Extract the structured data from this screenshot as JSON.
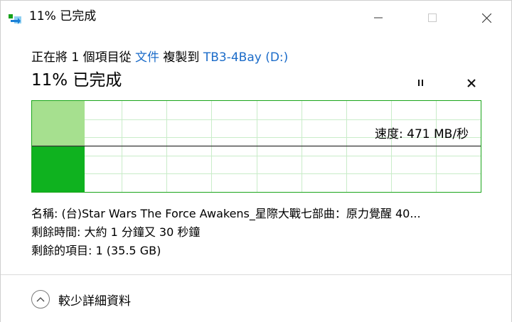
{
  "window": {
    "title": "11% 已完成"
  },
  "header": {
    "prefix": "正在將 1 個項目從 ",
    "source": "文件",
    "middle": " 複製到 ",
    "destination": "TB3-4Bay (D:)"
  },
  "status": {
    "percent_complete": 11,
    "label": "11% 已完成"
  },
  "graph": {
    "speed_label": "速度: 471 MB/秒",
    "progress_fraction": 0.11,
    "colors": {
      "border": "#1aa51a",
      "grid": "#c9ecc9",
      "completed_area": "#a6e08f",
      "speed_fill": "#0fb21f",
      "speed_line": "#333333"
    }
  },
  "details": {
    "name": "名稱: (台)Star Wars The Force Awakens_星際大戰七部曲：原力覺醒 40...",
    "time_remaining": "剩餘時間: 大約 1 分鐘又 30 秒鐘",
    "items_remaining": "剩餘的項目: 1 (35.5 GB)"
  },
  "footer": {
    "toggle_label": "較少詳細資料"
  },
  "icons": {
    "app": "file-copy-icon",
    "minimize": "minimize-icon",
    "maximize": "maximize-icon",
    "close": "close-icon",
    "pause": "pause-icon",
    "cancel": "cancel-icon",
    "collapse": "chevron-up-icon"
  }
}
